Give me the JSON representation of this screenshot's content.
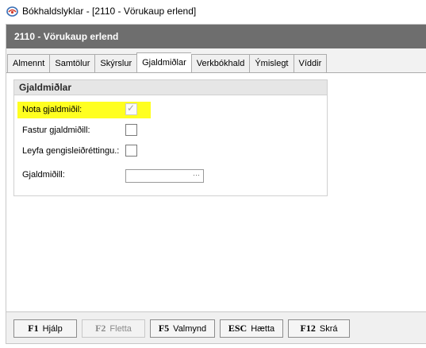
{
  "window": {
    "title": "Bókhaldslyklar - [2110 - Vörukaup erlend]",
    "icon": "app-logo-icon"
  },
  "header": {
    "title": "2110 - Vörukaup erlend"
  },
  "tabs": [
    {
      "label": "Almennt"
    },
    {
      "label": "Samtölur"
    },
    {
      "label": "Skýrslur"
    },
    {
      "label": "Gjaldmiðlar",
      "active": true
    },
    {
      "label": "Verkbókhald"
    },
    {
      "label": "Ýmislegt"
    },
    {
      "label": "Víddir"
    }
  ],
  "group": {
    "title": "Gjaldmiðlar",
    "fields": {
      "nota_gjaldmidil": {
        "label": "Nota gjaldmiðil:",
        "checked": true,
        "enabled": false,
        "highlight_color": "#ffff20"
      },
      "fastur_gjaldmidill": {
        "label": "Fastur gjaldmiðill:",
        "checked": false
      },
      "leyfa_gengisleidrettingu": {
        "label": "Leyfa gengisleiðréttingu.:",
        "checked": false
      },
      "gjaldmidill": {
        "label": "Gjaldmiðill:",
        "value": "",
        "button": "···"
      }
    }
  },
  "footer": {
    "buttons": [
      {
        "key": "F1",
        "label": "Hjálp",
        "enabled": true
      },
      {
        "key": "F2",
        "label": "Fletta",
        "enabled": false
      },
      {
        "key": "F5",
        "label": "Valmynd",
        "enabled": true
      },
      {
        "key": "ESC",
        "label": "Hætta",
        "enabled": true
      },
      {
        "key": "F12",
        "label": "Skrá",
        "enabled": true
      }
    ]
  },
  "colors": {
    "header_band": "#6e6e6e",
    "highlight": "#ffff20",
    "frame_background": "#f2f2f2"
  }
}
